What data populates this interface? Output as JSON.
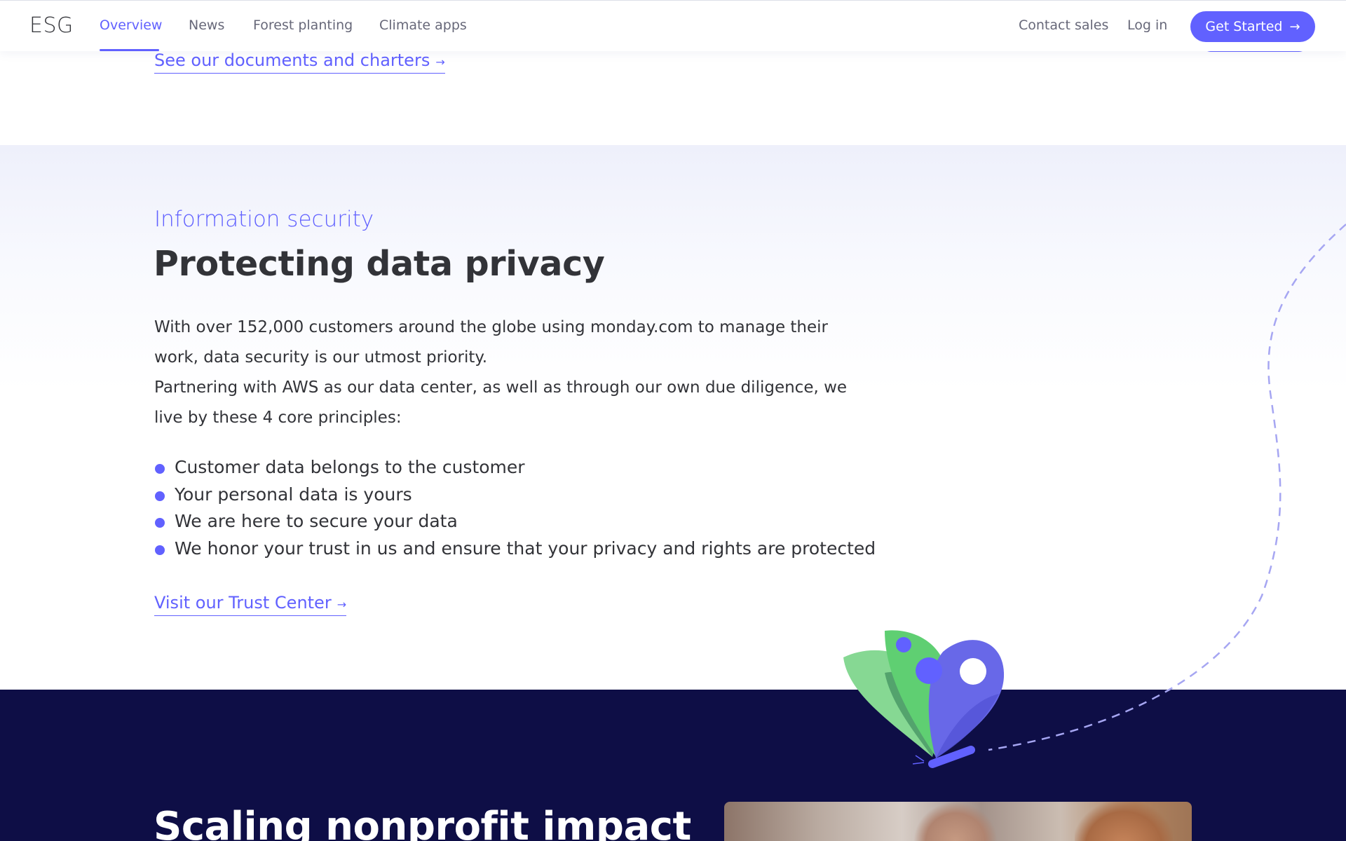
{
  "header": {
    "logo": "ESG",
    "nav": [
      {
        "label": "Overview",
        "active": true
      },
      {
        "label": "News",
        "active": false
      },
      {
        "label": "Forest planting",
        "active": false
      },
      {
        "label": "Climate apps",
        "active": false
      }
    ],
    "contact_sales": "Contact sales",
    "log_in": "Log in",
    "get_started": "Get Started",
    "get_started_icon": "arrow-right-icon"
  },
  "previous_section": {
    "link_label": "See our documents and charters",
    "link_icon": "arrow-right-icon"
  },
  "security": {
    "eyebrow": "Information security",
    "title": "Protecting data privacy",
    "paragraph_1": "With over 152,000 customers around the globe using monday.com to manage their work, data security is our utmost priority.",
    "paragraph_2": "Partnering with AWS as our data center, as well as through our own due diligence, we live by these 4 core principles:",
    "principles": [
      "Customer data belongs to the customer",
      "Your personal data is yours",
      "We are here to secure your data",
      "We honor your trust in us and ensure that your privacy and rights are protected"
    ],
    "link_label": "Visit our Trust Center",
    "link_icon": "arrow-right-icon"
  },
  "nonprofit": {
    "heading": "Scaling nonprofit impact",
    "image": "team-photo"
  },
  "colors": {
    "accent": "#6161ff",
    "text": "#323338",
    "dark_bg": "#0e0e46",
    "green": "#5fcf72",
    "light_green": "#86d893"
  }
}
